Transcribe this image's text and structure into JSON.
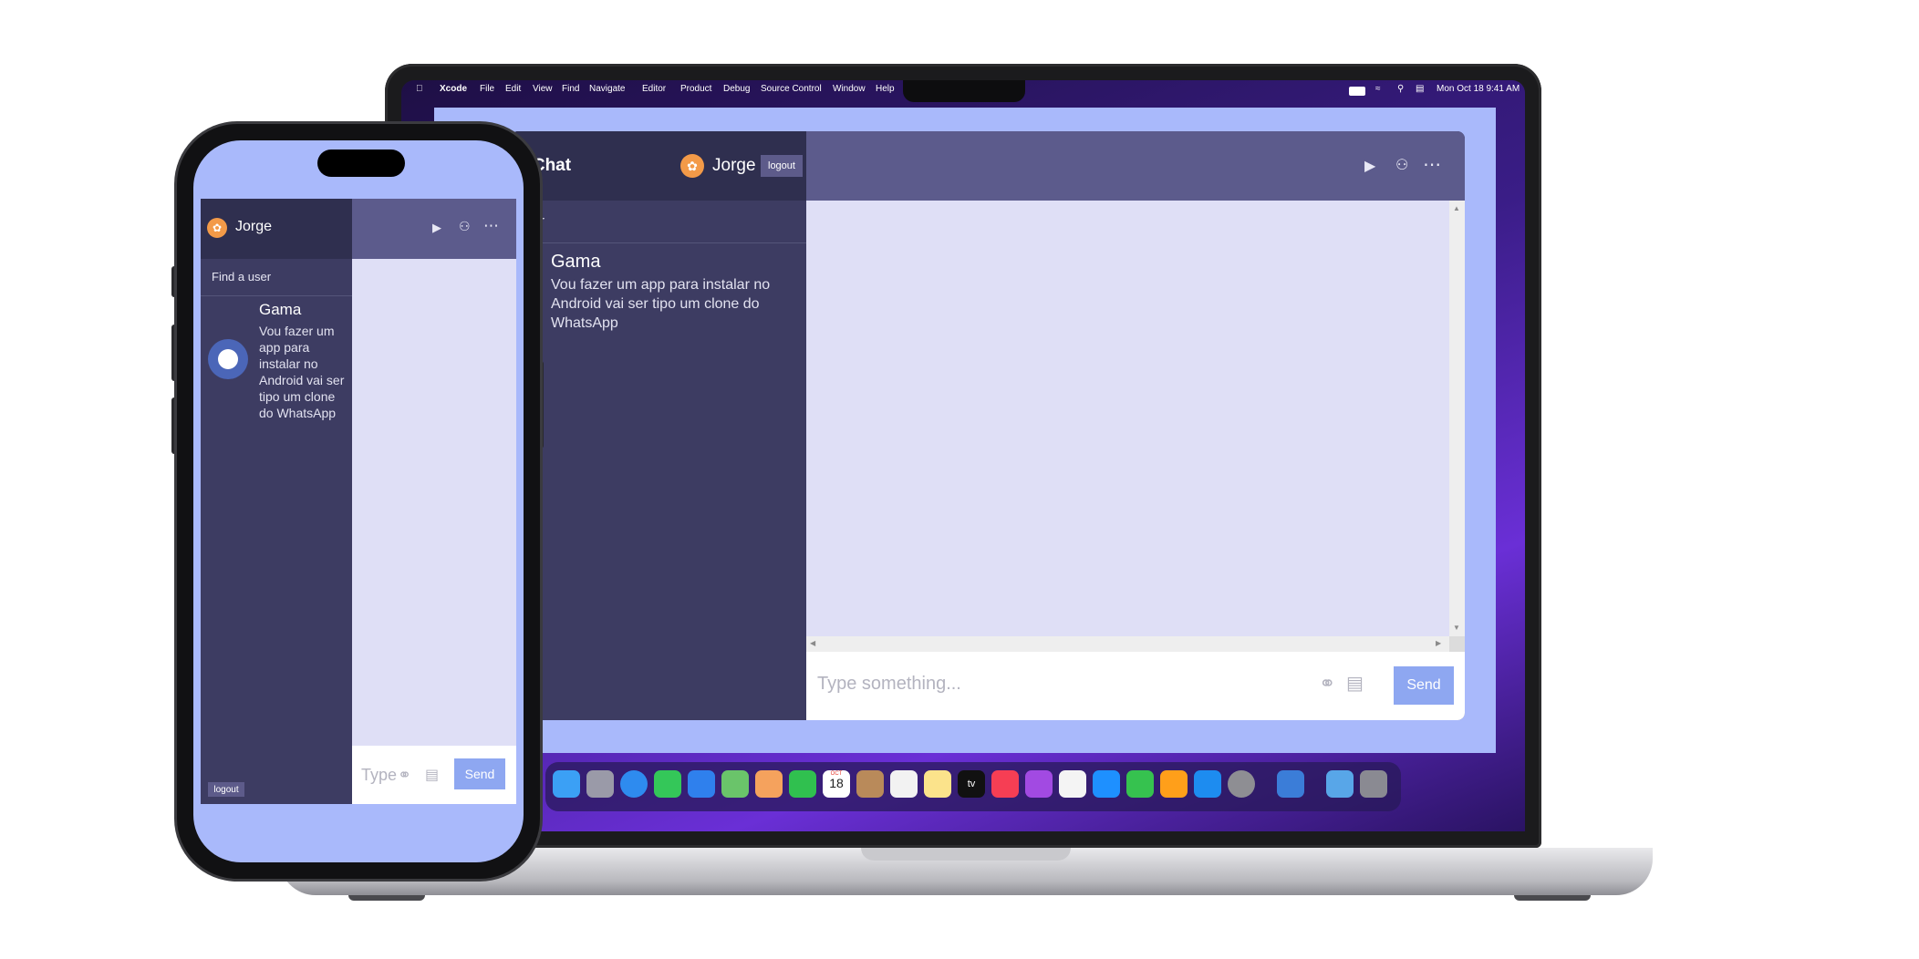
{
  "menubar": {
    "apple_icon": "apple-icon",
    "app_name": "Xcode",
    "menus": [
      "File",
      "Edit",
      "View",
      "Find",
      "Navigate",
      "Editor",
      "Product",
      "Debug",
      "Source Control",
      "Window",
      "Help"
    ],
    "clock": "Mon Oct 18  9:41 AM",
    "status_icons": [
      "battery-icon",
      "wifi-icon",
      "search-icon",
      "control-center-icon"
    ]
  },
  "laptop_app": {
    "brand_partial": "a Chat",
    "user": {
      "name": "Jorge",
      "avatar_icon": "fire-icon"
    },
    "logout_label": "logout",
    "search_partial": "ser",
    "contacts": [
      {
        "name": "Gama",
        "message": "Vou fazer um app para instalar no Android vai ser tipo um clone do WhatsApp"
      }
    ],
    "header_icons": [
      "video-camera-icon",
      "add-user-icon",
      "more-options-icon"
    ],
    "input_placeholder": "Type something...",
    "send_label": "Send",
    "attach_icon": "paperclip-icon",
    "image_icon": "image-icon"
  },
  "dock": {
    "date_badge": {
      "month": "OCT",
      "day": "18"
    },
    "tv_label": "tv"
  },
  "phone_app": {
    "user": {
      "name": "Jorge",
      "avatar_icon": "fire-icon"
    },
    "search_placeholder": "Find a user",
    "contacts": [
      {
        "name": "Gama",
        "message": "Vou fazer um app para instalar no Android vai ser tipo um clone do WhatsApp"
      }
    ],
    "header_icons": [
      "video-camera-icon",
      "add-user-icon",
      "more-options-icon"
    ],
    "input_placeholder": "Type",
    "send_label": "Send",
    "logout_label": "logout"
  },
  "colors": {
    "sidebar": "#3d3c62",
    "sidebar_header": "#2f2f4f",
    "chat_header": "#5c5b8c",
    "chat_background": "#dfdff6",
    "page_background": "#a9b9fb",
    "send_button": "#8ea7f1",
    "avatar_fire": "#f39a48"
  }
}
